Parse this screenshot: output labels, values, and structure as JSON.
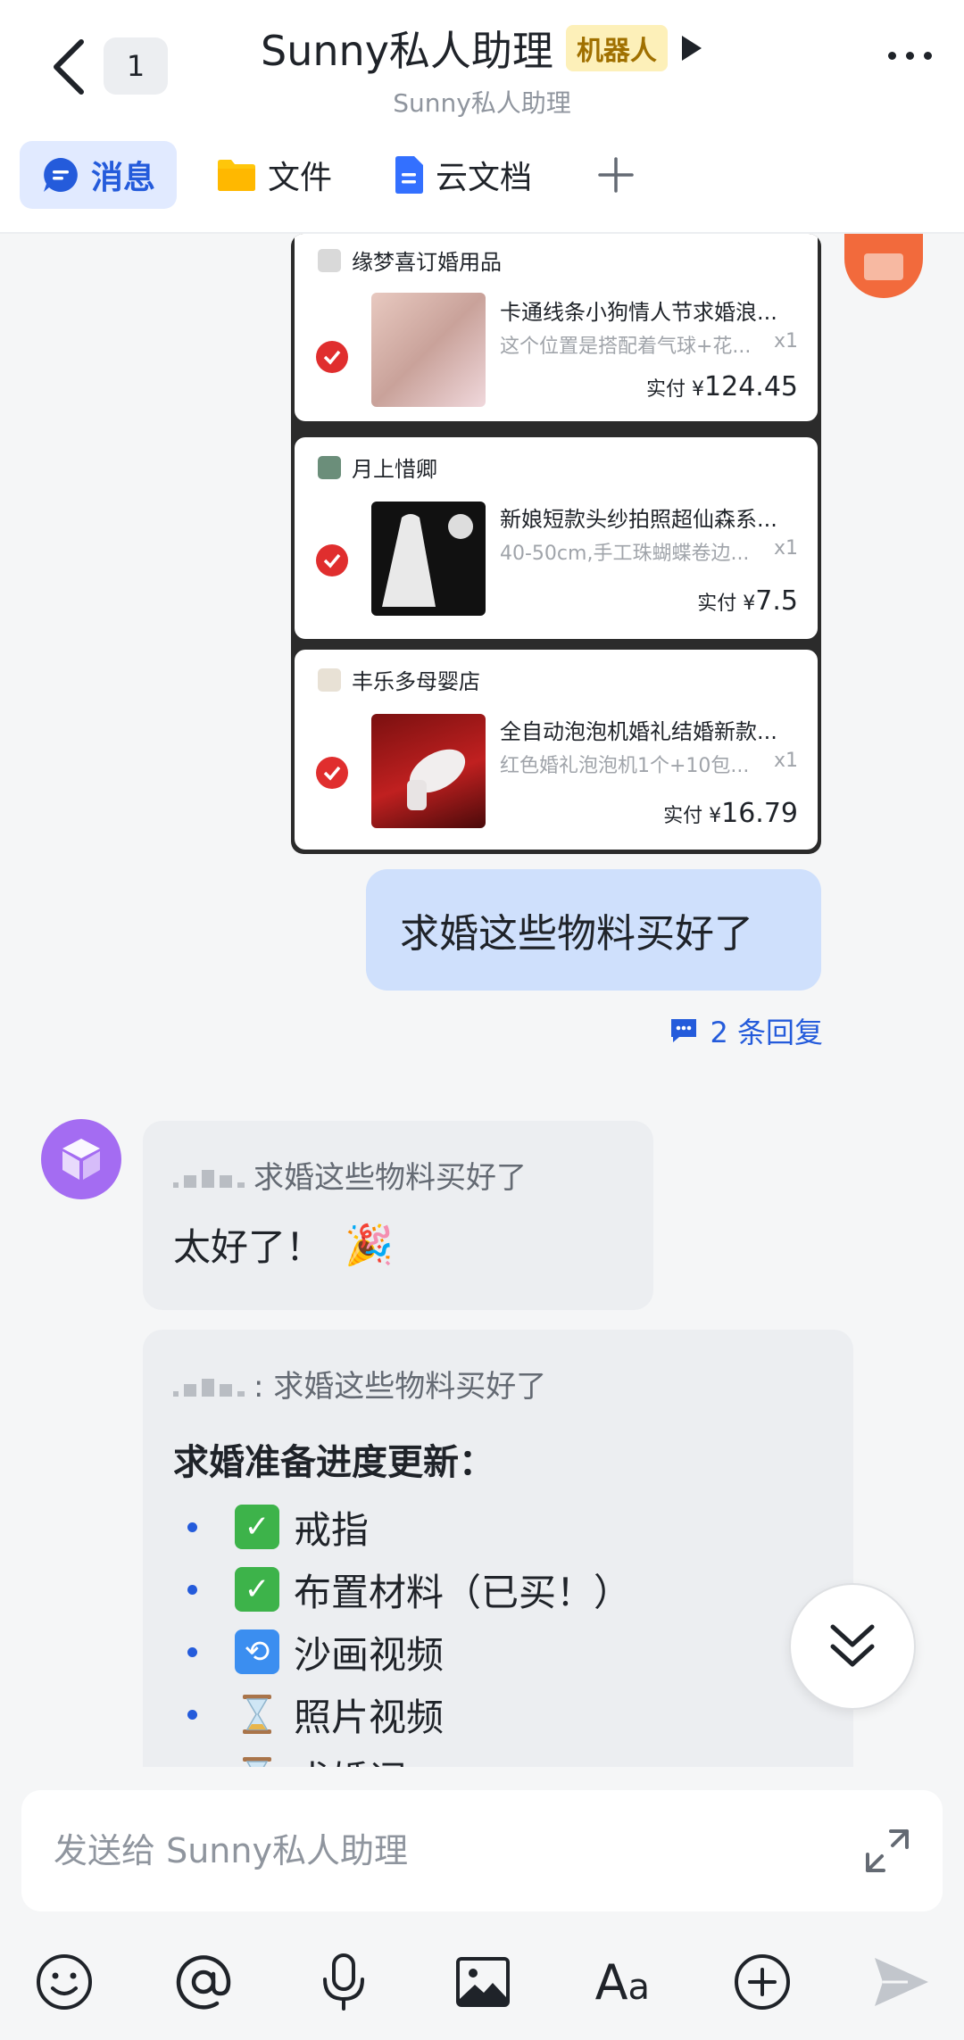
{
  "header": {
    "unread_count": "1",
    "title": "Sunny私人助理",
    "badge": "机器人",
    "subtitle": "Sunny私人助理"
  },
  "tabs": [
    {
      "label": "消息",
      "icon": "message-icon",
      "active": true
    },
    {
      "label": "文件",
      "icon": "folder-icon",
      "active": false
    },
    {
      "label": "云文档",
      "icon": "doc-icon",
      "active": false
    }
  ],
  "orders": [
    {
      "shop": "缘梦喜订婚用品",
      "name": "卡通线条小狗情人节求婚浪...",
      "spec": "这个位置是搭配着气球+花...",
      "qty": "x1",
      "price_label": "实付 ¥",
      "price": "124.45"
    },
    {
      "shop": "月上惜卿",
      "name": "新娘短款头纱拍照超仙森系...",
      "spec": "40-50cm,手工珠蝴蝶卷边...",
      "qty": "x1",
      "price_label": "实付 ¥",
      "price": "7.5"
    },
    {
      "shop": "丰乐多母婴店",
      "name": "全自动泡泡机婚礼结婚新款...",
      "spec": "红色婚礼泡泡机1个+10包...",
      "qty": "x1",
      "price_label": "实付 ¥",
      "price": "16.79"
    }
  ],
  "my_message": "求婚这些物料买好了",
  "replies_link": "2 条回复",
  "bot_reply_1": {
    "quote": "求婚这些物料买好了",
    "text": "太好了！",
    "emoji": "🎉"
  },
  "bot_reply_2": {
    "quote": ": 求婚这些物料买好了",
    "heading": "求婚准备进度更新：",
    "items": [
      {
        "icon": "✅",
        "text": "戒指"
      },
      {
        "icon": "✅",
        "text": "布置材料（已买！）"
      },
      {
        "icon": "🔄",
        "text": "沙画视频"
      },
      {
        "icon": "⏳",
        "text": "照片视频"
      },
      {
        "icon": "⏳",
        "text": "求婚词"
      }
    ]
  },
  "composer": {
    "placeholder": "发送给 Sunny私人助理",
    "format_label": "Aa"
  },
  "colors": {
    "accent": "#245bdb",
    "my_bubble": "#cfe0fc",
    "bot_bubble": "#eceef1",
    "badge_bg": "#fdf0b9"
  }
}
